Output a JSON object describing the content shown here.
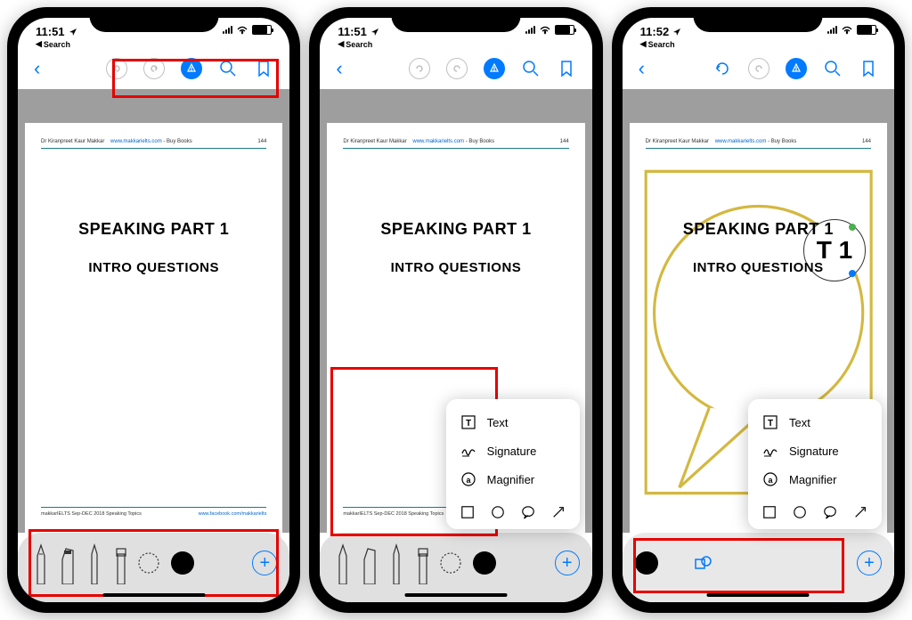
{
  "status": {
    "time1": "11:51",
    "time2": "11:51",
    "time3": "11:52",
    "back_label": "Search"
  },
  "nav": {
    "back": "‹"
  },
  "page": {
    "author": "Dr Kiranpreet Kaur Makkar",
    "url": "www.makkarielts.com",
    "buy": "- Buy Books",
    "num": "144",
    "title": "SPEAKING PART 1",
    "subtitle": "INTRO QUESTIONS",
    "footer_left": "makkarIELTS Sep-DEC 2018 Speaking Topics",
    "footer_right": "www.facebook.com/makkarielts"
  },
  "popup": {
    "text": "Text",
    "signature": "Signature",
    "magnifier": "Magnifier"
  },
  "magnifier_text": "T  1",
  "plus": "+"
}
